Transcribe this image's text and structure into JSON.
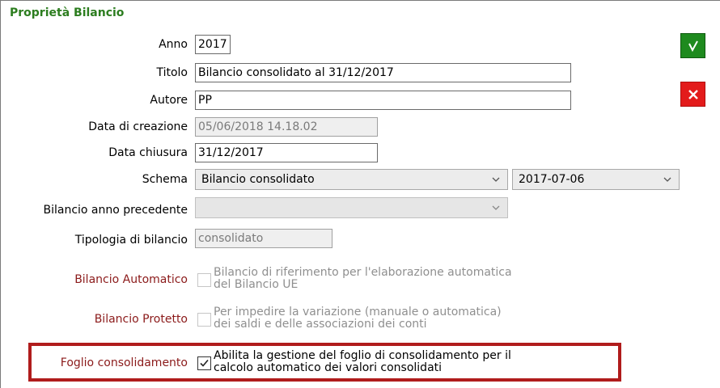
{
  "section_title": "Proprietà Bilancio",
  "fields": {
    "anno": {
      "label": "Anno",
      "value": "2017"
    },
    "titolo": {
      "label": "Titolo",
      "value": "Bilancio consolidato al 31/12/2017"
    },
    "autore": {
      "label": "Autore",
      "value": "PP"
    },
    "data_creazione": {
      "label": "Data di creazione",
      "value": "05/06/2018 14.18.02"
    },
    "data_chiusura": {
      "label": "Data chiusura",
      "value": "31/12/2017"
    },
    "schema": {
      "label": "Schema",
      "value": "Bilancio consolidato",
      "version": "2017-07-06"
    },
    "bilancio_precedente": {
      "label": "Bilancio anno precedente",
      "value": ""
    },
    "tipologia": {
      "label": "Tipologia di bilancio",
      "value": "consolidato"
    }
  },
  "checkboxes": {
    "automatico": {
      "label": "Bilancio Automatico",
      "line1": "Bilancio di riferimento per l'elaborazione automatica",
      "line2": "del Bilancio UE",
      "checked": false
    },
    "protetto": {
      "label": "Bilancio Protetto",
      "line1": "Per impedire  la variazione (manuale o automatica)",
      "line2": "dei saldi e delle associazioni dei conti",
      "checked": false
    },
    "foglio": {
      "label": "Foglio consolidamento",
      "line1": "Abilita la gestione del foglio di consolidamento per il",
      "line2": "calcolo automatico dei valori consolidati",
      "checked": true
    }
  },
  "buttons": {
    "confirm_icon": "check-icon",
    "cancel_icon": "close-icon"
  },
  "colors": {
    "title": "#2c7d1f",
    "label_red": "#8b1a1a",
    "highlight": "#b01c1c",
    "confirm": "#1e8a1e",
    "cancel": "#e31b1b"
  }
}
